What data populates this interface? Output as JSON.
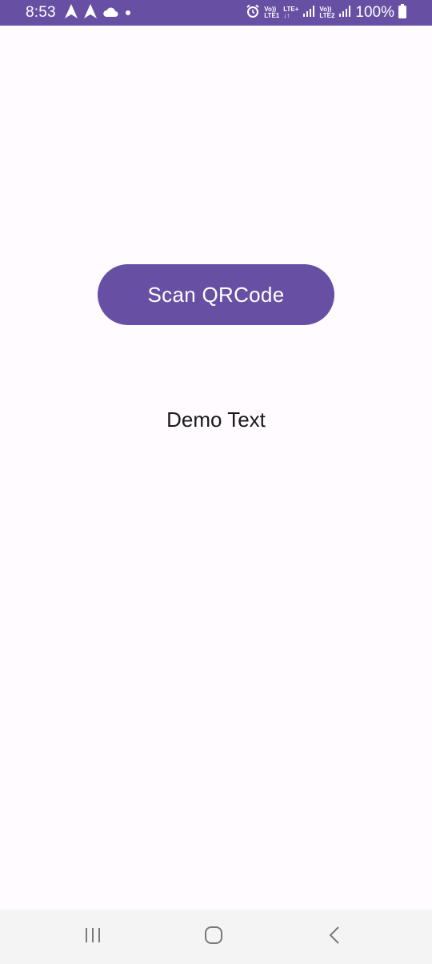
{
  "status_bar": {
    "time": "8:53",
    "battery_text": "100%",
    "net1_top": "Vo))",
    "net1_bottom": "LTE1",
    "net1_type": "LTE+",
    "net2_top": "Vo))",
    "net2_bottom": "LTE2",
    "icons": [
      "navigation-icon",
      "navigation-icon",
      "cloud-icon",
      "notification-dot-icon",
      "alarm-icon",
      "signal-icon",
      "signal-icon",
      "battery-icon"
    ],
    "background_color": "#6750a4"
  },
  "main": {
    "scan_button_label": "Scan QRCode",
    "demo_text": "Demo Text",
    "accent_color": "#6750a4"
  },
  "nav_bar": {
    "icons": [
      "recent-apps-icon",
      "home-icon",
      "back-icon"
    ]
  }
}
